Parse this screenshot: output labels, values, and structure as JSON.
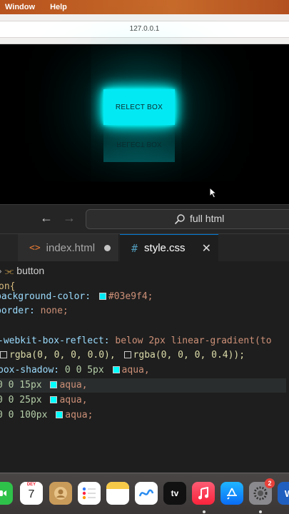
{
  "menubar": {
    "items": [
      "Window",
      "Help"
    ]
  },
  "browser": {
    "url": "127.0.0.1"
  },
  "preview": {
    "box_label": "RELECT BOX",
    "reflection_label": "RELECT BOX"
  },
  "toolbar": {
    "back_icon": "arrow-left",
    "forward_icon": "arrow-right",
    "command_center": "full html"
  },
  "tabs": [
    {
      "label": "index.html",
      "icon": "html-icon",
      "state": "unsaved"
    },
    {
      "label": "style.css",
      "icon": "css-icon",
      "state": "active"
    }
  ],
  "breadcrumb": {
    "symbol": "button"
  },
  "code": {
    "l0": "on{",
    "l1_prop": "background-color:",
    "l1_val": "#03e9f4;",
    "l2_prop": "border:",
    "l2_val": "none;",
    "l3_prop": "-webkit-box-reflect:",
    "l3_rest": "below 2px linear-gradient(to",
    "l4_a": "rgba(0, 0, 0, 0.0),",
    "l4_b": "rgba(0, 0, 0, 0.4));",
    "l5_prop": "box-shadow:",
    "l5_nums": "0 0 5px",
    "l5_val": "aqua,",
    "l6_nums": "0 0 15px",
    "l6_val": "aqua,",
    "l7_nums": "0 0 25px",
    "l7_val": "aqua,",
    "l8_nums": "0 0 100px",
    "l8_val": "aqua;"
  },
  "colors": {
    "accent": "#03e9f4",
    "aqua": "#00ffff"
  },
  "dock": {
    "calendar_month": "DEY",
    "calendar_day": "7",
    "appletv_label": "tv",
    "settings_badge": "2"
  }
}
